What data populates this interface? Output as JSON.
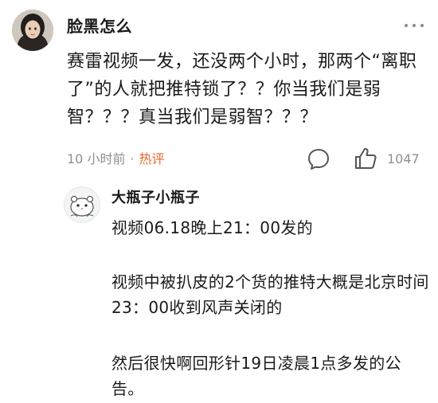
{
  "comment": {
    "username": "脸黑怎么",
    "avatar_icon": "user-avatar-photo",
    "text": "赛雷视频一发，还没两个小时，那两个“离职了”的人就把推特锁了？？你当我们是弱智？？？真当我们是弱智？？？",
    "time": "10 小时前",
    "separator": "·",
    "hot_label": "热评",
    "like_count": "1047",
    "more_icon": "more-dots-icon",
    "reply_icon": "comment-bubble-icon",
    "like_icon": "thumbs-up-icon"
  },
  "reply": {
    "username": "大瓶子小瓶子",
    "avatar_icon": "hamster-avatar",
    "paragraphs": [
      "视频06.18晚上21：00发的",
      "视频中被扒皮的2个货的推特大概是北京时间23：00收到风声关闭的",
      "然后很快啊回形针19日凌晨1点多发的公告。"
    ]
  },
  "colors": {
    "hot": "#e8672f",
    "meta": "#8f8f8f",
    "text": "#1a1a1a"
  }
}
